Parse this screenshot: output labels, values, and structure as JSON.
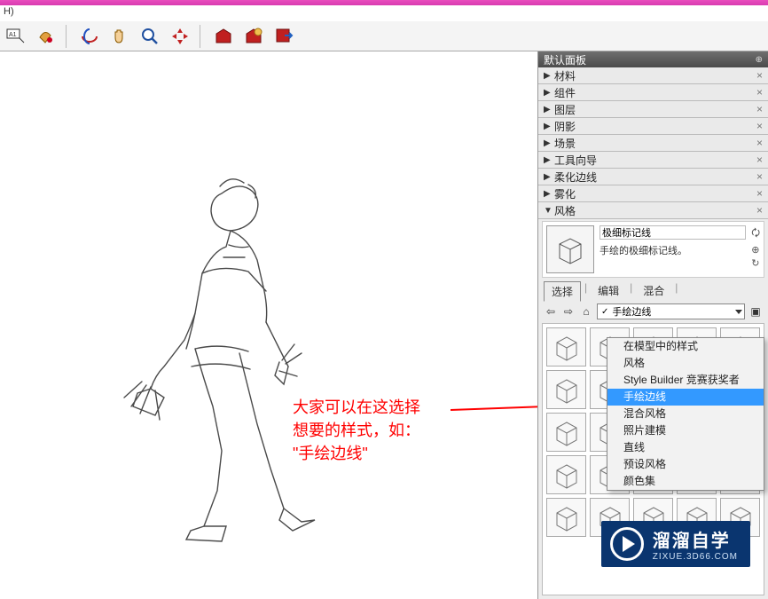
{
  "menu_label": "H)",
  "panel": {
    "title": "默认面板",
    "sections": [
      {
        "label": "材料",
        "expanded": false
      },
      {
        "label": "组件",
        "expanded": false
      },
      {
        "label": "图层",
        "expanded": false
      },
      {
        "label": "阴影",
        "expanded": false
      },
      {
        "label": "场景",
        "expanded": false
      },
      {
        "label": "工具向导",
        "expanded": false
      },
      {
        "label": "柔化边线",
        "expanded": false
      },
      {
        "label": "雾化",
        "expanded": false
      },
      {
        "label": "风格",
        "expanded": true
      }
    ],
    "style_name": "极细标记线",
    "style_desc": "手绘的极细标记线。",
    "tabs": {
      "select": "选择",
      "edit": "编辑",
      "mix": "混合"
    },
    "combo_value": "手绘边线",
    "dropdown_items": [
      "在模型中的样式",
      "风格",
      "Style Builder 竞赛获奖者",
      "手绘边线",
      "混合风格",
      "照片建模",
      "直线",
      "预设风格",
      "颜色集"
    ],
    "dropdown_selected_index": 3
  },
  "annotation": {
    "line1": "大家可以在这选择",
    "line2": "想要的样式，如：",
    "line3": "\"手绘边线\""
  },
  "watermark": {
    "name": "溜溜自学",
    "url": "ZIXUE.3D66.COM"
  }
}
